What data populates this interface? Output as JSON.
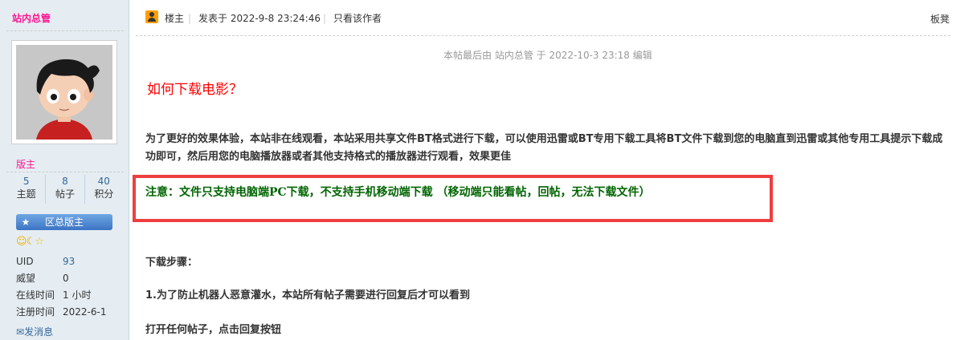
{
  "author": {
    "username": "站内总管",
    "role": "版主",
    "stats": [
      {
        "value": "5",
        "label": "主题"
      },
      {
        "value": "8",
        "label": "帖子"
      },
      {
        "value": "40",
        "label": "积分"
      }
    ],
    "group": "区总版主",
    "info": [
      {
        "key": "UID",
        "value": "93"
      },
      {
        "key": "威望",
        "value": "0"
      },
      {
        "key": "在线时间",
        "value": "1 小时"
      },
      {
        "key": "注册时间",
        "value": "2022-6-1"
      }
    ],
    "pm_label": "发消息"
  },
  "post": {
    "op_label": "楼主",
    "posted_at": "发表于 2022-9-8 23:24:46",
    "only_author": "只看该作者",
    "floor": "板凳",
    "edit_note": "本帖最后由 站内总管 于 2022-10-3 23:18 编辑",
    "title": "如何下载电影？",
    "paragraph": "为了更好的效果体验，本站非在线观看，本站采用共享文件BT格式进行下载，可以使用迅雷或BT专用下载工具将BT文件下载到您的电脑直到迅雷或其他专用工具提示下载成功即可，然后用您的电脑播放器或者其他支持格式的播放器进行观看，效果更佳",
    "notice": "注意：文件只支持电脑端PC下载，不支持手机移动端下载 （移动端只能看帖，回帖，无法下载文件）",
    "steps_title": "下载步骤：",
    "step1": "1.为了防止机器人恶意灌水，本站所有帖子需要进行回复后才可以看到",
    "step2": "打开任何帖子，点击回复按钮"
  },
  "colors": {
    "username": "#ff1493",
    "title": "#ff0000",
    "notice": "#006400",
    "notice_border": "#ed3f3f",
    "sidebar_bg": "#e5edf2"
  },
  "icons": {
    "op": "user-icon",
    "group": "star-icon",
    "medals": [
      "sun-medal-icon",
      "moon-medal-icon",
      "star-medal-icon"
    ],
    "pm": "envelope-icon"
  }
}
